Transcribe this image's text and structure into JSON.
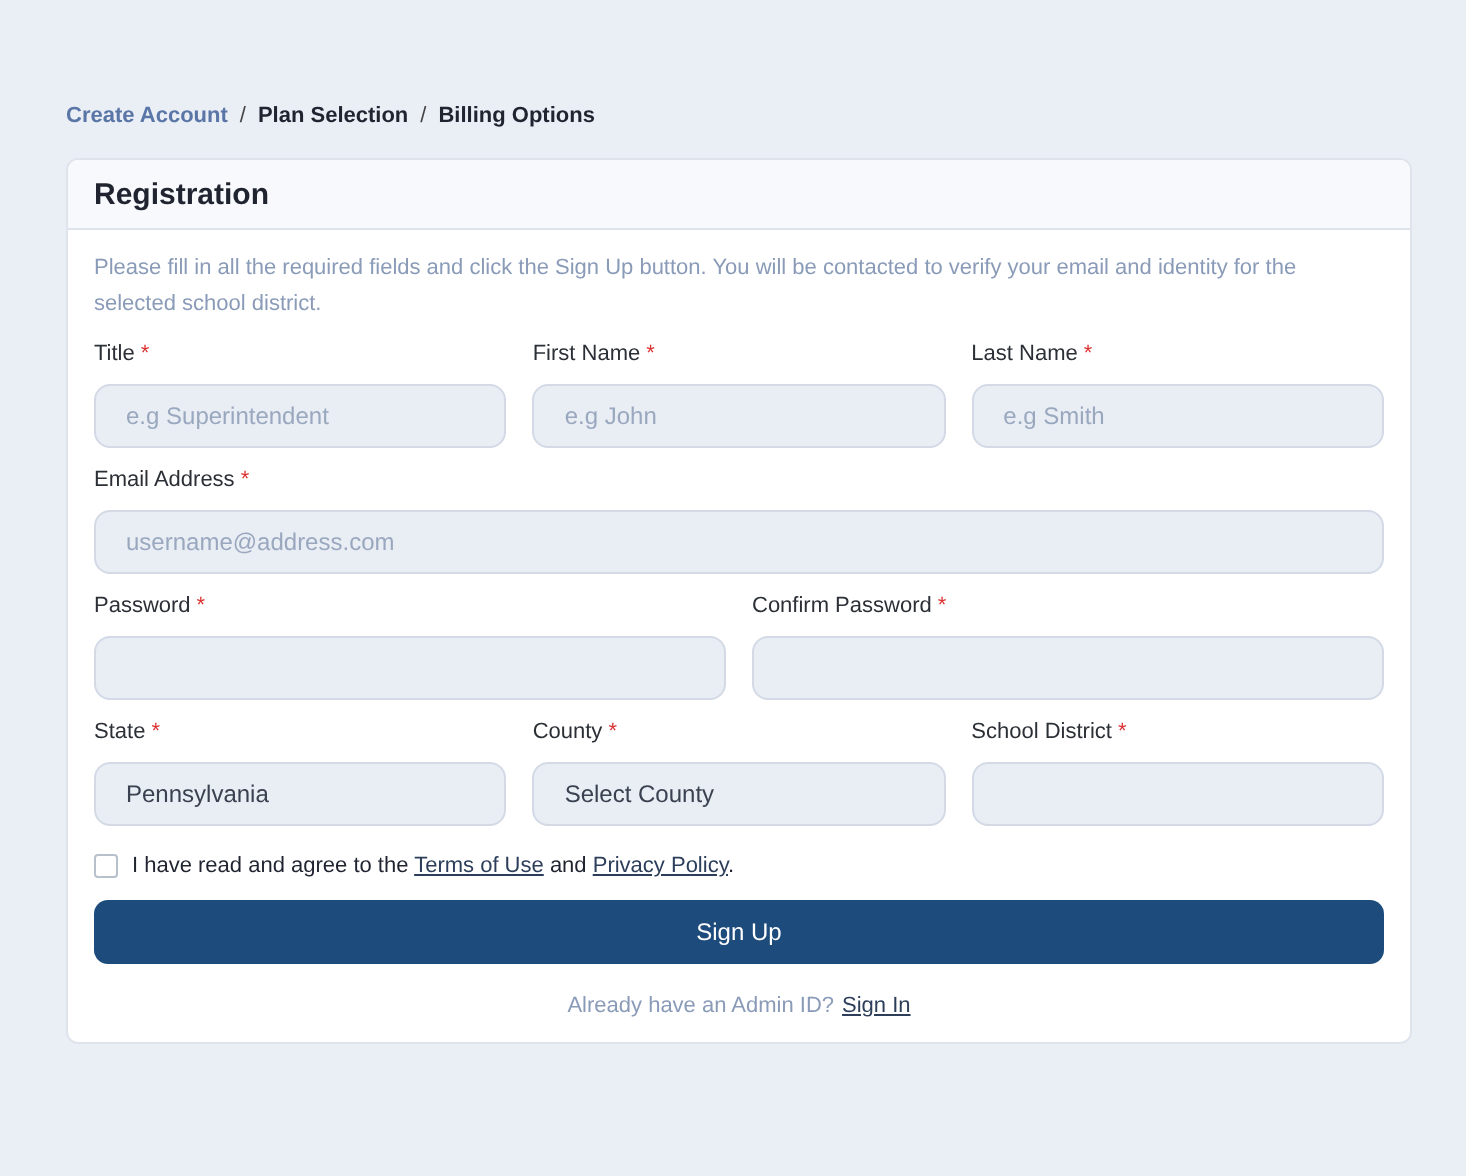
{
  "breadcrumb": [
    {
      "label": "Create Account",
      "kind": "link"
    },
    {
      "label": "Plan Selection",
      "kind": "step"
    },
    {
      "label": "Billing Options",
      "kind": "step"
    }
  ],
  "breadcrumb_separator": "/",
  "card": {
    "title": "Registration",
    "description": "Please fill in all the required fields and click the Sign Up button. You will be contacted to verify your email and identity for the selected school district."
  },
  "rows": [
    {
      "fields": [
        {
          "label": "Title",
          "mark": "*",
          "placeholder": "e.g Superintendent"
        },
        {
          "label": "First Name",
          "mark": "*",
          "placeholder": "e.g John"
        },
        {
          "label": "Last Name",
          "mark": "*",
          "placeholder": "e.g Smith"
        }
      ]
    },
    {
      "fields": [
        {
          "label": "Email Address",
          "mark": "*",
          "placeholder": "username@address.com"
        }
      ]
    },
    {
      "fields": [
        {
          "label": "Password",
          "mark": "*"
        },
        {
          "label": "Confirm Password",
          "mark": "*"
        }
      ]
    },
    {
      "fields": [
        {
          "label": "State",
          "mark": "*",
          "value": "Pennsylvania"
        },
        {
          "label": "County",
          "mark": "*",
          "value": "Select County"
        },
        {
          "label": "School District",
          "mark": "*"
        }
      ]
    }
  ],
  "agreement": {
    "checked": false,
    "parts": [
      {
        "kind": "text",
        "text": "I have read and agree to the"
      },
      {
        "kind": "link",
        "text": "Terms of Use"
      },
      {
        "kind": "text",
        "text": "and"
      },
      {
        "kind": "link",
        "text": "Privacy Policy"
      },
      {
        "kind": "end",
        "text": "."
      }
    ]
  },
  "submit": "Sign Up",
  "footer": {
    "text": "Already have an Admin ID?",
    "link": "Sign In"
  }
}
